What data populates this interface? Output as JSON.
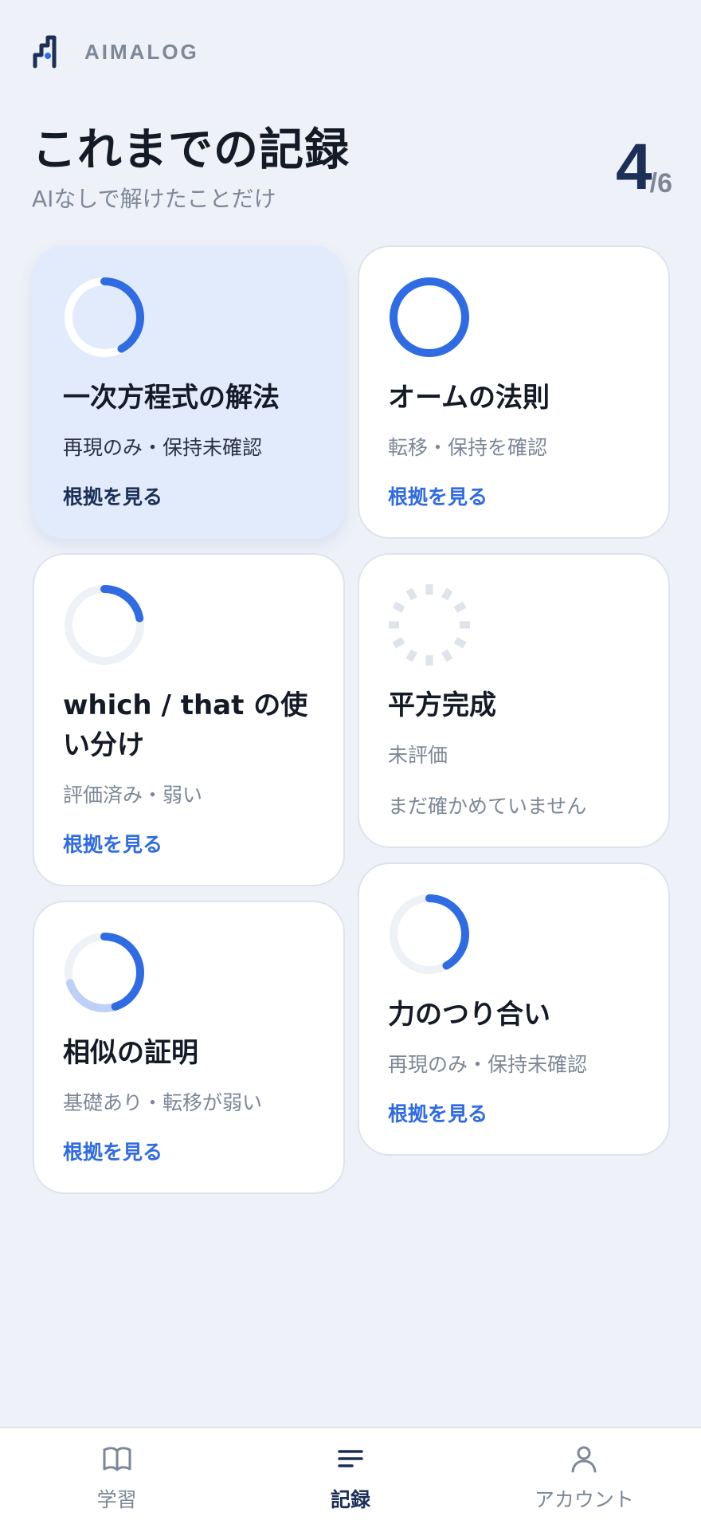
{
  "app": {
    "brand": "AIMALOG",
    "logo_icon": "staircase-logo-icon"
  },
  "header": {
    "title": "これまでの記録",
    "subtitle": "AIなしで解けたことだけ",
    "score": {
      "value": "4",
      "separator": "/",
      "total": "6"
    }
  },
  "cards": [
    {
      "title": "一次方程式の解法",
      "status": "再現のみ・保持未確認",
      "link": "根拠を見る",
      "active": true,
      "progress": 0.42,
      "secondary": 0
    },
    {
      "title": "オームの法則",
      "status": "転移・保持を確認",
      "link": "根拠を見る",
      "active": false,
      "progress": 1.0,
      "secondary": 0
    },
    {
      "title": "which / that の使い分け",
      "status": "評価済み・弱い",
      "link": "根拠を見る",
      "active": false,
      "progress": 0.22,
      "secondary": 0
    },
    {
      "title": "平方完成",
      "status": "未評価",
      "note": "まだ確かめていません",
      "active": false,
      "progress": 0,
      "secondary": 0,
      "unrated": true
    },
    {
      "title": "相似の証明",
      "status": "基礎あり・転移が弱い",
      "link": "根拠を見る",
      "active": false,
      "progress": 0.45,
      "secondary": 0.25
    },
    {
      "title": "力のつり合い",
      "status": "再現のみ・保持未確認",
      "link": "根拠を見る",
      "active": false,
      "progress": 0.42,
      "secondary": 0
    }
  ],
  "colors": {
    "accent": "#2f6be3",
    "accent_light": "#bdd0f5",
    "track": "#eef1f6",
    "navy": "#1b2f57",
    "muted": "#7d8797"
  },
  "nav": {
    "items": [
      {
        "label": "学習",
        "icon": "book-icon",
        "active": false
      },
      {
        "label": "記録",
        "icon": "list-icon",
        "active": true
      },
      {
        "label": "アカウント",
        "icon": "user-icon",
        "active": false
      }
    ]
  }
}
